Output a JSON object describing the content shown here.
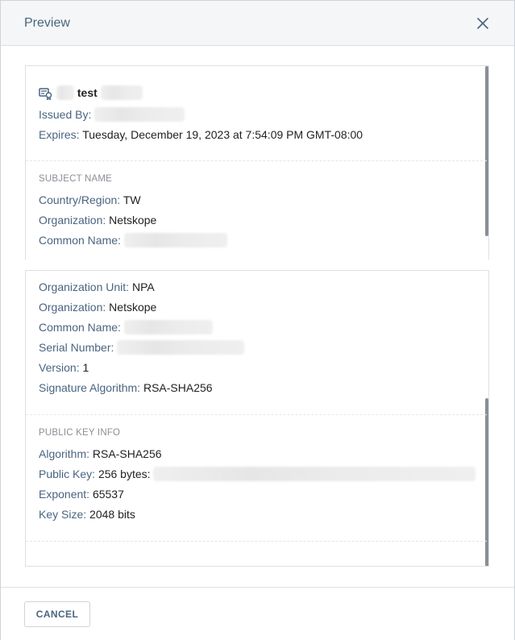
{
  "dialog": {
    "title": "Preview",
    "close_icon": "close-icon",
    "cancel_label": "CANCEL"
  },
  "certificate": {
    "icon": "certificate-icon",
    "name_visible": "test",
    "issued_by_label": "Issued By:",
    "expires_label": "Expires:",
    "expires_value": "Tuesday, December 19, 2023 at 7:54:09 PM GMT-08:00"
  },
  "subject_name": {
    "title": "SUBJECT NAME",
    "country_label": "Country/Region:",
    "country_value": "TW",
    "organization_label": "Organization:",
    "organization_value": "Netskope",
    "common_name_label": "Common Name:"
  },
  "issuer": {
    "org_unit_label": "Organization Unit:",
    "org_unit_value": "NPA",
    "organization_label": "Organization:",
    "organization_value": "Netskope",
    "common_name_label": "Common Name:",
    "serial_label": "Serial Number:",
    "version_label": "Version:",
    "version_value": "1",
    "sig_alg_label": "Signature Algorithm:",
    "sig_alg_value": "RSA-SHA256"
  },
  "public_key": {
    "title": "PUBLIC KEY INFO",
    "algorithm_label": "Algorithm:",
    "algorithm_value": "RSA-SHA256",
    "key_label": "Public Key:",
    "key_value": "256 bytes:",
    "exponent_label": "Exponent:",
    "exponent_value": "65537",
    "key_size_label": "Key Size:",
    "key_size_value": "2048 bits"
  },
  "colors": {
    "label": "#4a6480",
    "header_bg": "#f5f6f7",
    "border": "#dde0e4"
  }
}
